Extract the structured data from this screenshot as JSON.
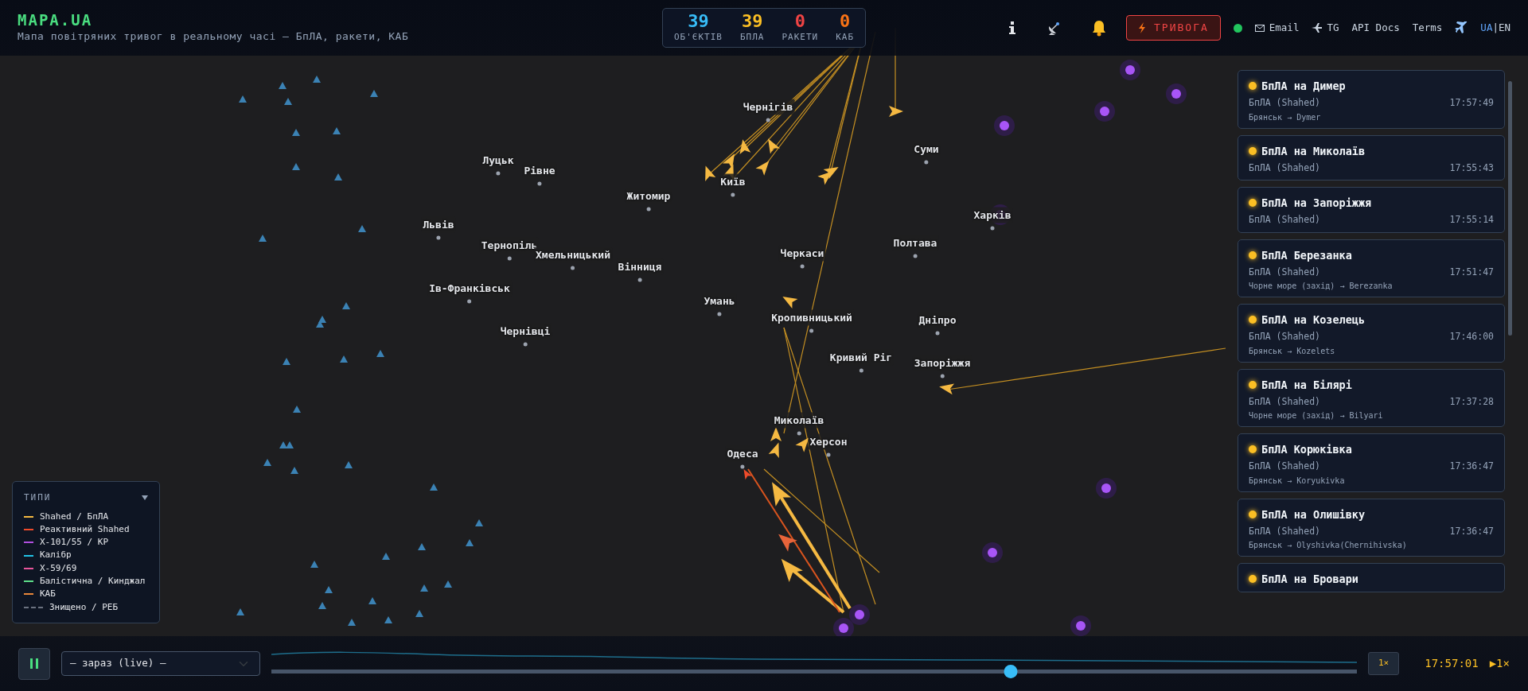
{
  "header": {
    "logo": "MAPA.UA",
    "subtitle": "Мапа повітряних тривог в реальному часі — БпЛА, ракети, КАБ"
  },
  "stats": [
    {
      "value": "39",
      "label": "ОБ'ЄКТІВ",
      "color": "#38bdf8"
    },
    {
      "value": "39",
      "label": "БПЛА",
      "color": "#fbbf24"
    },
    {
      "value": "0",
      "label": "РАКЕТИ",
      "color": "#ef4444"
    },
    {
      "value": "0",
      "label": "КАБ",
      "color": "#f97316"
    }
  ],
  "toolbar": {
    "alert_button": "ТРИВОГА",
    "online": true,
    "links": [
      {
        "kind": "email",
        "label": "Email"
      },
      {
        "kind": "telegram",
        "label": "TG"
      },
      {
        "kind": "plain",
        "label": "API Docs"
      },
      {
        "kind": "plain",
        "label": "Terms"
      }
    ],
    "languages": [
      {
        "label": "UA",
        "selected": true
      },
      {
        "label": "EN",
        "selected": false
      }
    ],
    "language_separator": "|"
  },
  "cities": [
    "Чернігів",
    "Суми",
    "Луцьк",
    "Рівне",
    "Житомир",
    "Київ",
    "Харків",
    "Львів",
    "Тернопіль",
    "Хмельницький",
    "Вінниця",
    "Черкаси",
    "Полтава",
    "Ів-Франківськ",
    "Умань",
    "Кропивницький",
    "Дніпро",
    "Чернівці",
    "Кривий Ріг",
    "Запоріжжя",
    "Миколаїв",
    "Херсон",
    "Одеса"
  ],
  "events": [
    {
      "title": "БпЛА на Димер",
      "type": "БпЛА (Shahed)",
      "time": "17:57:49",
      "route": "Брянськ → Dymer",
      "color": "#fbbf24"
    },
    {
      "title": "БпЛА на Миколаїв",
      "type": "БпЛА (Shahed)",
      "time": "17:55:43",
      "color": "#fbbf24"
    },
    {
      "title": "БпЛА на Запоріжжя",
      "type": "БпЛА (Shahed)",
      "time": "17:55:14",
      "color": "#fbbf24"
    },
    {
      "title": "БпЛА Березанка",
      "type": "БпЛА (Shahed)",
      "time": "17:51:47",
      "route": "Чорне море (захід) → Berezanka",
      "color": "#fbbf24"
    },
    {
      "title": "БпЛА на Козелець",
      "type": "БпЛА (Shahed)",
      "time": "17:46:00",
      "route": "Брянськ → Kozelets",
      "color": "#fbbf24"
    },
    {
      "title": "БпЛА на Білярі",
      "type": "БпЛА (Shahed)",
      "time": "17:37:28",
      "route": "Чорне море (захід) → Bilyari",
      "color": "#fbbf24"
    },
    {
      "title": "БпЛА Корюківка",
      "type": "БпЛА (Shahed)",
      "time": "17:36:47",
      "route": "Брянськ → Koryukivka",
      "color": "#fbbf24"
    },
    {
      "title": "БпЛА на Олишівку",
      "type": "БпЛА (Shahed)",
      "time": "17:36:47",
      "route": "Брянськ → Olyshivka(Chernihivska)",
      "color": "#fbbf24"
    },
    {
      "title": "БпЛА на Бровари",
      "color": "#fbbf24"
    }
  ],
  "legend": {
    "title": "ТИПИ",
    "expanded": true,
    "items": [
      {
        "label": "Shahed / БпЛА",
        "color": "#f5b942",
        "kind": "solid"
      },
      {
        "label": "Реактивний Shahed",
        "color": "#ef4b2b",
        "kind": "solid"
      },
      {
        "label": "Х-101/55 / КР",
        "color": "#b04fe0",
        "kind": "solid"
      },
      {
        "label": "Калібр",
        "color": "#22c3e6",
        "kind": "solid"
      },
      {
        "label": "Х-59/69",
        "color": "#e8559b",
        "kind": "solid"
      },
      {
        "label": "Балістична / Кинджал",
        "color": "#5ee08a",
        "kind": "solid"
      },
      {
        "label": "КАБ",
        "color": "#e8873a",
        "kind": "solid"
      },
      {
        "label": "Знищено / РЕБ",
        "color": "#6b7280",
        "kind": "dashed"
      }
    ]
  },
  "playback": {
    "playing": true,
    "period": "— зараз (live) —",
    "level": 0.681,
    "speed_button": "1×",
    "clock": "17:57:01",
    "speed_indicator": "▶1×"
  }
}
